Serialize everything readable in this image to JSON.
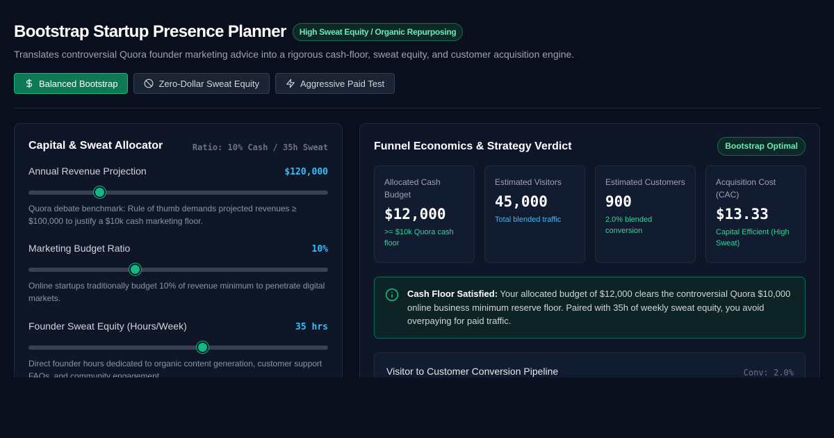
{
  "header": {
    "title": "Bootstrap Startup Presence Planner",
    "badge": "High Sweat Equity / Organic Repurposing",
    "subtitle": "Translates controversial Quora founder marketing advice into a rigorous cash-floor, sweat equity, and customer acquisition engine."
  },
  "presets": [
    {
      "label": "Balanced Bootstrap",
      "icon": "dollar-icon",
      "active": true
    },
    {
      "label": "Zero-Dollar Sweat Equity",
      "icon": "ban-icon",
      "active": false
    },
    {
      "label": "Aggressive Paid Test",
      "icon": "lightning-icon",
      "active": false
    }
  ],
  "allocator": {
    "title": "Capital & Sweat Allocator",
    "ratio": "Ratio: 10% Cash / 35h Sweat",
    "controls": [
      {
        "label": "Annual Revenue Projection",
        "value": "$120,000",
        "level": 0.237,
        "description": "Quora debate benchmark: Rule of thumb demands projected revenues ≥ $100,000 to justify a $10k cash marketing floor."
      },
      {
        "label": "Marketing Budget Ratio",
        "value": "10%",
        "level": 0.355,
        "description": "Online startups traditionally budget 10% of revenue minimum to penetrate digital markets."
      },
      {
        "label": "Founder Sweat Equity (Hours/Week)",
        "value": "35 hrs",
        "level": 0.58,
        "description": "Direct founder hours dedicated to organic content generation, customer support FAQs, and community engagement."
      }
    ]
  },
  "verdict": {
    "title": "Funnel Economics & Strategy Verdict",
    "badge": "Bootstrap Optimal",
    "metrics": [
      {
        "label": "Allocated Cash Budget",
        "value": "$12,000",
        "note": ">= $10k Quora cash floor",
        "note_color": "#34d399"
      },
      {
        "label": "Estimated Visitors",
        "value": "45,000",
        "note": "Total blended traffic",
        "note_color": "#38bdf8"
      },
      {
        "label": "Estimated Customers",
        "value": "900",
        "note": "2.0% blended conversion",
        "note_color": "#34d399"
      },
      {
        "label": "Acquisition Cost (CAC)",
        "value": "$13.33",
        "note": "Capital Efficient (High Sweat)",
        "note_color": "#34d399"
      }
    ],
    "alert": {
      "heading": "Cash Floor Satisfied:",
      "body": " Your allocated budget of $12,000 clears the controversial Quora $10,000 online business minimum reserve floor. Paired with 35h of weekly sweat equity, you avoid overpaying for paid traffic."
    },
    "pipeline": {
      "title": "Visitor to Customer Conversion Pipeline",
      "conversion": "Conv: 2.0%"
    }
  },
  "colors": {
    "accent": "#10b981",
    "value_blue": "#38bdf8",
    "background": "#0a0f1e"
  }
}
